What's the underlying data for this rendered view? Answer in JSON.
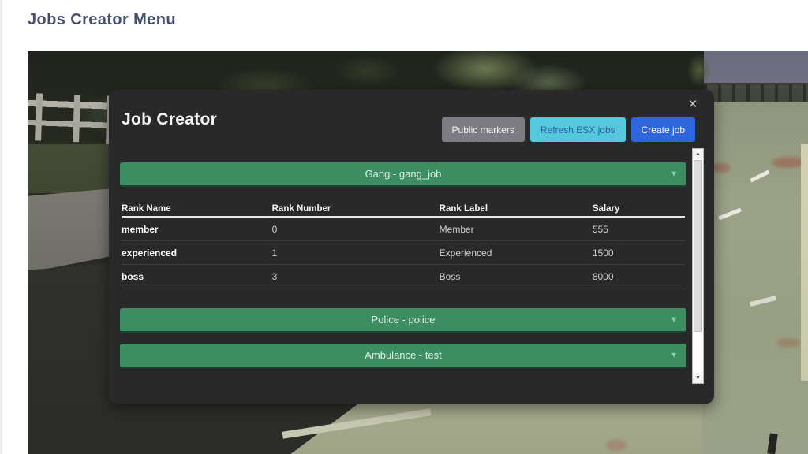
{
  "page": {
    "title": "Jobs Creator Menu"
  },
  "modal": {
    "title": "Job Creator",
    "close_glyph": "×",
    "buttons": {
      "public_markers": "Public markers",
      "refresh_esx": "Refresh ESX jobs",
      "create_job": "Create job"
    },
    "accordions": [
      {
        "label": "Gang - gang_job",
        "caret": "▼"
      },
      {
        "label": "Police - police",
        "caret": "▼"
      },
      {
        "label": "Ambulance - test",
        "caret": "▼"
      }
    ],
    "table": {
      "headers": [
        "Rank Name",
        "Rank Number",
        "Rank Label",
        "Salary"
      ],
      "rows": [
        {
          "name": "member",
          "number": "0",
          "label": "Member",
          "salary": "555"
        },
        {
          "name": "experienced",
          "number": "1",
          "label": "Experienced",
          "salary": "1500"
        },
        {
          "name": "boss",
          "number": "3",
          "label": "Boss",
          "salary": "8000"
        }
      ]
    },
    "scrollbar": {
      "up_glyph": "▲",
      "down_glyph": "▼"
    }
  },
  "colors": {
    "accent_green": "#3c8e62",
    "button_gray": "#7d7c82",
    "button_cyan": "#55c8de",
    "button_blue": "#2d65dd",
    "panel_bg": "#292929",
    "page_title_text": "#44516e"
  }
}
